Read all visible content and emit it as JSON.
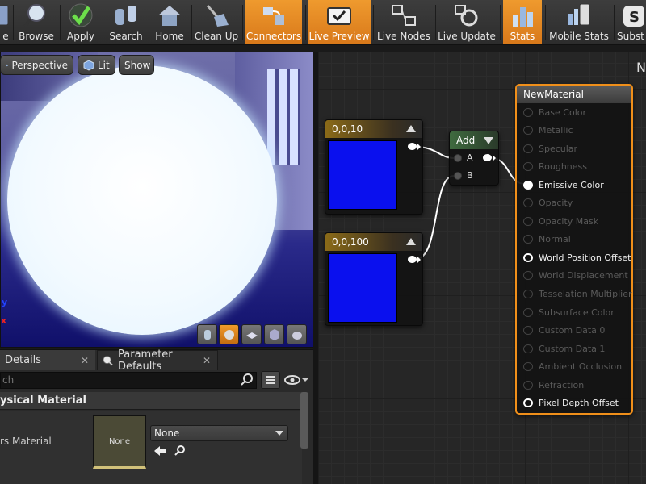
{
  "toolbar": {
    "items": [
      {
        "label": "e",
        "icon": "save-icon",
        "active": false
      },
      {
        "label": "Browse",
        "icon": "magnifier-icon",
        "active": false
      },
      {
        "label": "Apply",
        "icon": "checkmark-icon",
        "active": false
      },
      {
        "label": "Search",
        "icon": "binoculars-icon",
        "active": false
      },
      {
        "label": "Home",
        "icon": "house-icon",
        "active": false
      },
      {
        "label": "Clean Up",
        "icon": "broom-icon",
        "active": false
      },
      {
        "label": "Connectors",
        "icon": "connectors-icon",
        "active": true
      },
      {
        "label": "Live Preview",
        "icon": "tv-check-icon",
        "active": true
      },
      {
        "label": "Live Nodes",
        "icon": "live-nodes-icon",
        "active": false
      },
      {
        "label": "Live Update",
        "icon": "live-update-icon",
        "active": false
      },
      {
        "label": "Stats",
        "icon": "bar-chart-icon",
        "active": true
      },
      {
        "label": "Mobile Stats",
        "icon": "mobile-stats-icon",
        "active": false
      },
      {
        "label": "Subst",
        "icon": "substance-icon",
        "active": false
      }
    ]
  },
  "viewport": {
    "perspective_label": "Perspective",
    "lit_label": "Lit",
    "show_label": "Show",
    "axis_y": "y",
    "axis_x": "x",
    "preview_buttons": [
      "cylinder-icon",
      "sphere-icon",
      "plane-icon",
      "cube-icon",
      "teapot-icon"
    ]
  },
  "details_panel": {
    "tab_details": "Details",
    "tab_param_defaults": "Parameter Defaults",
    "tab_close": "✕",
    "search_placeholder": "ch",
    "category": "ysical Material",
    "property_label": "rs Material",
    "thumbnail_text": "None",
    "combo_value": "None"
  },
  "graph": {
    "corner_letter": "N",
    "const_nodes": [
      {
        "title": "0,0,10",
        "color": "#0a10ee"
      },
      {
        "title": "0,0,100",
        "color": "#0a10ee"
      }
    ],
    "add_node": {
      "title": "Add",
      "pin_a": "A",
      "pin_b": "B"
    },
    "material_node": {
      "title": "NewMaterial",
      "pins": [
        {
          "label": "Base Color",
          "state": "disabled"
        },
        {
          "label": "Metallic",
          "state": "disabled"
        },
        {
          "label": "Specular",
          "state": "disabled"
        },
        {
          "label": "Roughness",
          "state": "disabled"
        },
        {
          "label": "Emissive Color",
          "state": "connected"
        },
        {
          "label": "Opacity",
          "state": "disabled"
        },
        {
          "label": "Opacity Mask",
          "state": "disabled"
        },
        {
          "label": "Normal",
          "state": "disabled"
        },
        {
          "label": "World Position Offset",
          "state": "enabled"
        },
        {
          "label": "World Displacement",
          "state": "disabled"
        },
        {
          "label": "Tesselation Multiplier",
          "state": "disabled"
        },
        {
          "label": "Subsurface Color",
          "state": "disabled"
        },
        {
          "label": "Custom Data 0",
          "state": "disabled"
        },
        {
          "label": "Custom Data 1",
          "state": "disabled"
        },
        {
          "label": "Ambient Occlusion",
          "state": "disabled"
        },
        {
          "label": "Refraction",
          "state": "disabled"
        },
        {
          "label": "Pixel Depth Offset",
          "state": "enabled"
        }
      ]
    }
  },
  "colors": {
    "accent_orange": "#f08f1a",
    "swatch_blue": "#0a10ee",
    "disabled_text": "#5a5a5a"
  }
}
